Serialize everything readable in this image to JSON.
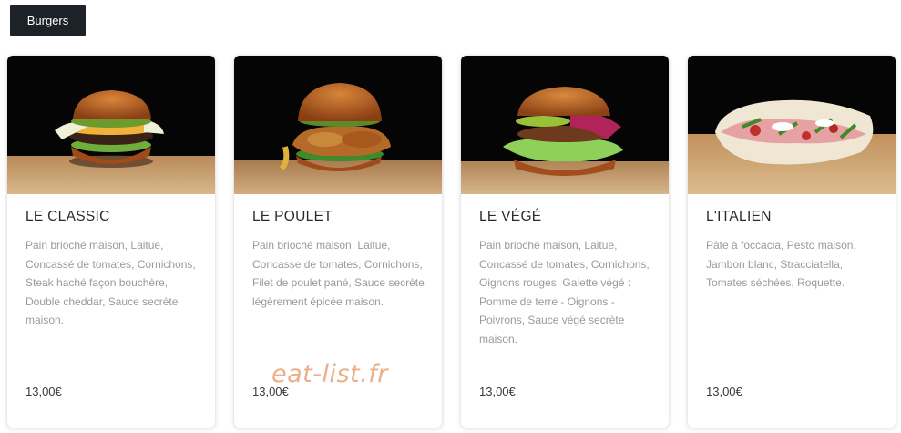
{
  "tabs": [
    {
      "label": "Burgers"
    }
  ],
  "products": [
    {
      "name": "LE CLASSIC",
      "description": "Pain brioché maison, Laitue, Concassé de tomates, Cornichons, Steak haché façon bouchère, Double cheddar, Sauce secrète maison.",
      "price": "13,00€",
      "image": "classic-burger-photo"
    },
    {
      "name": "LE POULET",
      "description": "Pain brioché maison, Laitue, Concasse de tomates, Cornichons, Filet de poulet pané, Sauce secrète légèrement épicée maison.",
      "price": "13,00€",
      "image": "chicken-burger-photo"
    },
    {
      "name": "LE VÉGÉ",
      "description": "Pain brioché maison, Laitue, Concassé de tomates, Cornichons, Oignons rouges, Galette végé : Pomme de terre - Oignons - Poivrons, Sauce végé secrète maison.",
      "price": "13,00€",
      "image": "veggie-burger-photo"
    },
    {
      "name": "L'ITALIEN",
      "description": "Pâte à foccacia, Pesto maison, Jambon blanc, Stracciatella, Tomates séchées, Roquette.",
      "price": "13,00€",
      "image": "focaccia-sandwich-photo"
    }
  ],
  "watermark": "eat-list.fr",
  "colors": {
    "tab_bg": "#1d2128",
    "title": "#2a2a2a",
    "description": "#9a9a9a",
    "watermark": "#e9a77d"
  }
}
